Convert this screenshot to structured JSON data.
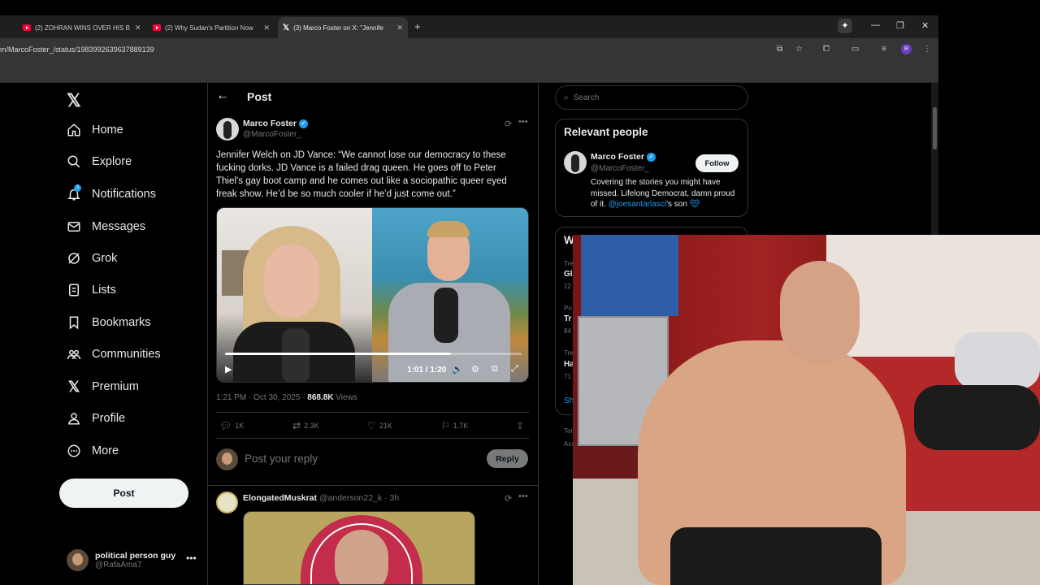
{
  "browser": {
    "tabs": [
      {
        "title": "(2) ZOHRAN WINS OVER HIS B",
        "favicon": "youtube-icon"
      },
      {
        "title": "(2) Why Sudan's Partition Now",
        "favicon": "youtube-icon"
      },
      {
        "title": "(3) Marco Foster on X: \"Jennife",
        "favicon": "x-icon",
        "active": true
      }
    ],
    "url": "m/MarcoFoster_/status/1983992639637889139",
    "profile_initial": "R"
  },
  "sidebar": {
    "items": [
      {
        "label": "Home",
        "icon": "home-icon"
      },
      {
        "label": "Explore",
        "icon": "search-icon"
      },
      {
        "label": "Notifications",
        "icon": "bell-icon",
        "badge": "3"
      },
      {
        "label": "Messages",
        "icon": "mail-icon"
      },
      {
        "label": "Grok",
        "icon": "grok-icon"
      },
      {
        "label": "Lists",
        "icon": "list-icon"
      },
      {
        "label": "Bookmarks",
        "icon": "bookmark-icon"
      },
      {
        "label": "Communities",
        "icon": "communities-icon"
      },
      {
        "label": "Premium",
        "icon": "x-premium-icon"
      },
      {
        "label": "Profile",
        "icon": "person-icon"
      },
      {
        "label": "More",
        "icon": "more-circle-icon"
      }
    ],
    "post_button": "Post",
    "account": {
      "name": "political person guy",
      "handle": "@RafaAma7"
    }
  },
  "post": {
    "header": "Post",
    "author": {
      "name": "Marco Foster",
      "handle": "@MarcoFoster_"
    },
    "text": "Jennifer Welch on JD Vance: “We cannot lose our democracy to these fucking dorks. JD Vance is a failed drag queen. He goes off to Peter Thiel’s gay boot camp and he comes out like a sociopathic queer eyed freak show. He’d be so much cooler if he’d just come out.”",
    "video": {
      "time": "1:01 / 1:20",
      "progress": 0.7625
    },
    "meta": {
      "time": "1:21 PM · Oct 30, 2025 · ",
      "views_count": "868.8K",
      "views_label": " Views"
    },
    "actions": {
      "replies": "1K",
      "reposts": "2.3K",
      "likes": "21K",
      "bookmarks": "1.7K"
    },
    "reply_placeholder": "Post your reply",
    "reply_button": "Reply"
  },
  "reply_tweet": {
    "name": "ElongatedMuskrat",
    "handle": "@anderson22_k",
    "time": "· 3h"
  },
  "right": {
    "search_placeholder": "Search",
    "relevant_people": {
      "title": "Relevant people",
      "name": "Marco Foster",
      "handle": "@MarcoFoster_",
      "follow": "Follow",
      "bio_text": "Covering the stories you might have missed. Lifelong Democrat, damn proud of it. ",
      "bio_link": "@joesantarlasci",
      "bio_suffix": "’s son "
    },
    "trends_fragments": {
      "title": "W",
      "t1a": "Tre",
      "t1b": "Gl",
      "t1c": "22",
      "t2a": "Po",
      "t2b": "Tr",
      "t2c": "84",
      "t3a": "Tre",
      "t3b": "Ha",
      "t3c": "71",
      "show": "Sh",
      "f1": "Ter",
      "f2": "Acc"
    }
  }
}
